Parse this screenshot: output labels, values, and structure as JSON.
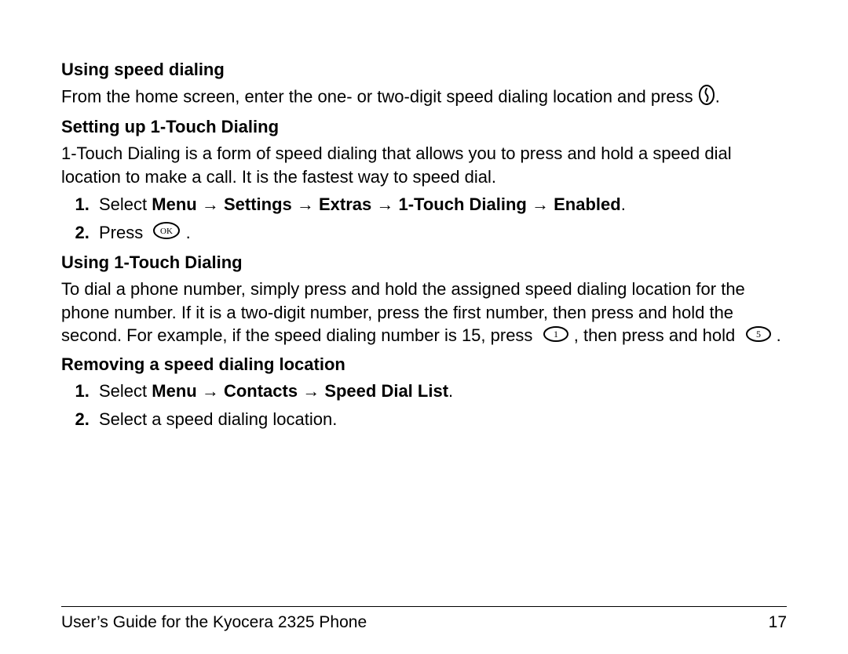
{
  "sections": {
    "speed_dialing": {
      "heading": "Using speed dialing",
      "body_before_icon": "From the home screen, enter the one- or two-digit speed dialing location and press ",
      "body_after_icon": "."
    },
    "setup_1touch": {
      "heading": "Setting up 1-Touch Dialing",
      "intro": "1-Touch Dialing is a form of speed dialing that allows you to press and hold a speed dial location to make a call. It is the fastest way to speed dial.",
      "step1_prefix": "Select ",
      "step1_path_pieces": [
        "Menu",
        "Settings",
        "Extras",
        "1-Touch Dialing",
        "Enabled"
      ],
      "step1_arrow": " → ",
      "step1_period": ".",
      "step2_prefix": "Press ",
      "step2_period": "."
    },
    "using_1touch": {
      "heading": "Using 1-Touch Dialing",
      "body_before": "To dial a phone number, simply press and hold the assigned speed dialing location for the phone number. If it is a two-digit number, press the first number, then press and hold the second. For example, if the speed dialing number is 15, press ",
      "body_mid": ", then press and hold ",
      "body_after": "."
    },
    "removing": {
      "heading": "Removing a speed dialing location",
      "step1_prefix": "Select ",
      "step1_path_pieces": [
        "Menu",
        "Contacts",
        "Speed Dial List"
      ],
      "step1_arrow": " → ",
      "step1_period": ".",
      "step2": "Select a speed dialing location."
    }
  },
  "icons": {
    "send_key": {
      "name": "send-key-icon",
      "glyph": "("
    },
    "ok_key": {
      "name": "ok-key-icon",
      "glyph": "OK"
    },
    "key_1": {
      "name": "key-1-icon",
      "glyph": "1"
    },
    "key_5": {
      "name": "key-5-icon",
      "glyph": "5"
    }
  },
  "footer": {
    "title": "User’s Guide for the Kyocera 2325 Phone",
    "page": "17"
  }
}
